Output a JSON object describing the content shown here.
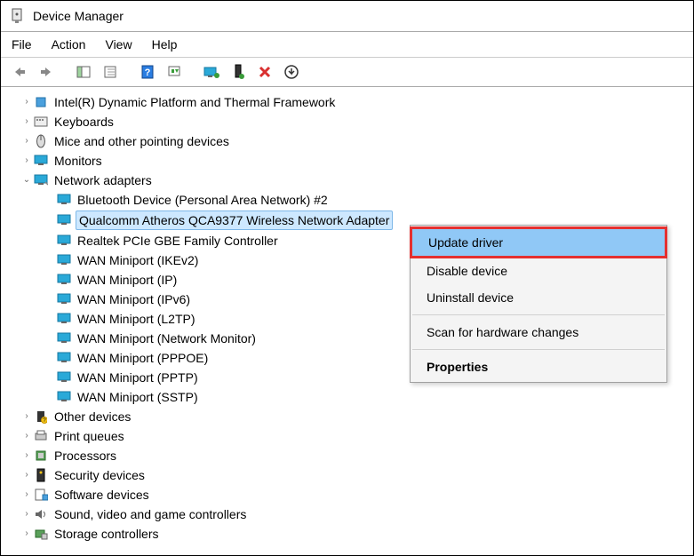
{
  "window": {
    "title": "Device Manager"
  },
  "menus": {
    "file": "File",
    "action": "Action",
    "view": "View",
    "help": "Help"
  },
  "tree": {
    "items": {
      "intel": "Intel(R) Dynamic Platform and Thermal Framework",
      "keyboards": "Keyboards",
      "mice": "Mice and other pointing devices",
      "monitors": "Monitors",
      "netadapters": "Network adapters",
      "bt": "Bluetooth Device (Personal Area Network) #2",
      "qca": "Qualcomm Atheros QCA9377 Wireless Network Adapter",
      "realtek": "Realtek PCIe GBE Family Controller",
      "wm_ikev2": "WAN Miniport (IKEv2)",
      "wm_ip": "WAN Miniport (IP)",
      "wm_ipv6": "WAN Miniport (IPv6)",
      "wm_l2tp": "WAN Miniport (L2TP)",
      "wm_netmon": "WAN Miniport (Network Monitor)",
      "wm_pppoe": "WAN Miniport (PPPOE)",
      "wm_pptp": "WAN Miniport (PPTP)",
      "wm_sstp": "WAN Miniport (SSTP)",
      "other": "Other devices",
      "printq": "Print queues",
      "processors": "Processors",
      "security": "Security devices",
      "software": "Software devices",
      "sound": "Sound, video and game controllers",
      "storage": "Storage controllers"
    }
  },
  "ctx": {
    "update": "Update driver",
    "disable": "Disable device",
    "uninstall": "Uninstall device",
    "scan": "Scan for hardware changes",
    "props": "Properties"
  }
}
